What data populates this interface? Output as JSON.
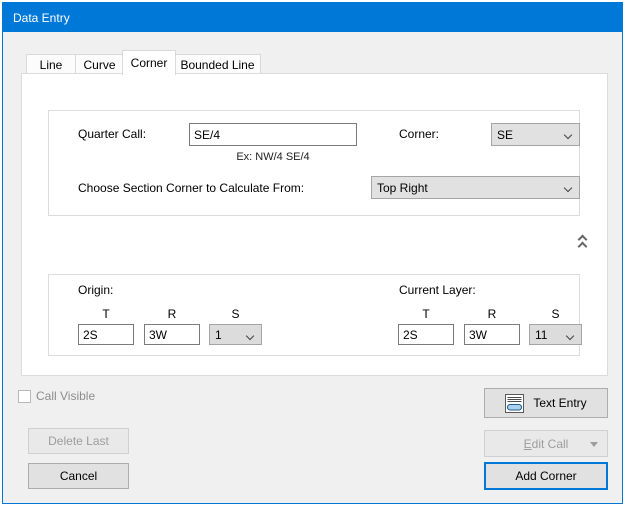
{
  "window": {
    "title": "Data Entry",
    "accent_color": "#0078d7",
    "dialog_bg": "#f0f0f0"
  },
  "tabs": [
    {
      "label": "Line",
      "selected": false
    },
    {
      "label": "Curve",
      "selected": false
    },
    {
      "label": "Corner",
      "selected": true
    },
    {
      "label": "Bounded Line",
      "selected": false
    }
  ],
  "form": {
    "quarter_call": {
      "label": "Quarter Call:",
      "value": "SE/4",
      "hint": "Ex: NW/4 SE/4"
    },
    "corner": {
      "label": "Corner:",
      "value": "SE"
    },
    "section_corner": {
      "label": "Choose Section Corner to Calculate From:",
      "value": "Top Right"
    }
  },
  "collapse": {
    "icon": "chevron-double-up"
  },
  "origin": {
    "label": "Origin:",
    "t_label": "T",
    "r_label": "R",
    "s_label": "S",
    "t_value": "2S",
    "r_value": "3W",
    "s_value": "1"
  },
  "current_layer": {
    "label": "Current Layer:",
    "t_label": "T",
    "r_label": "R",
    "s_label": "S",
    "t_value": "2S",
    "r_value": "3W",
    "s_value": "11"
  },
  "footer": {
    "call_visible": {
      "label": "Call Visible",
      "checked": false,
      "enabled": false
    },
    "text_entry_label": "Text Entry",
    "delete_last_label": "Delete Last",
    "edit_call": {
      "accel": "E",
      "rest": "dit Call",
      "enabled": false
    },
    "cancel_label": "Cancel",
    "add_corner_label": "Add Corner"
  }
}
